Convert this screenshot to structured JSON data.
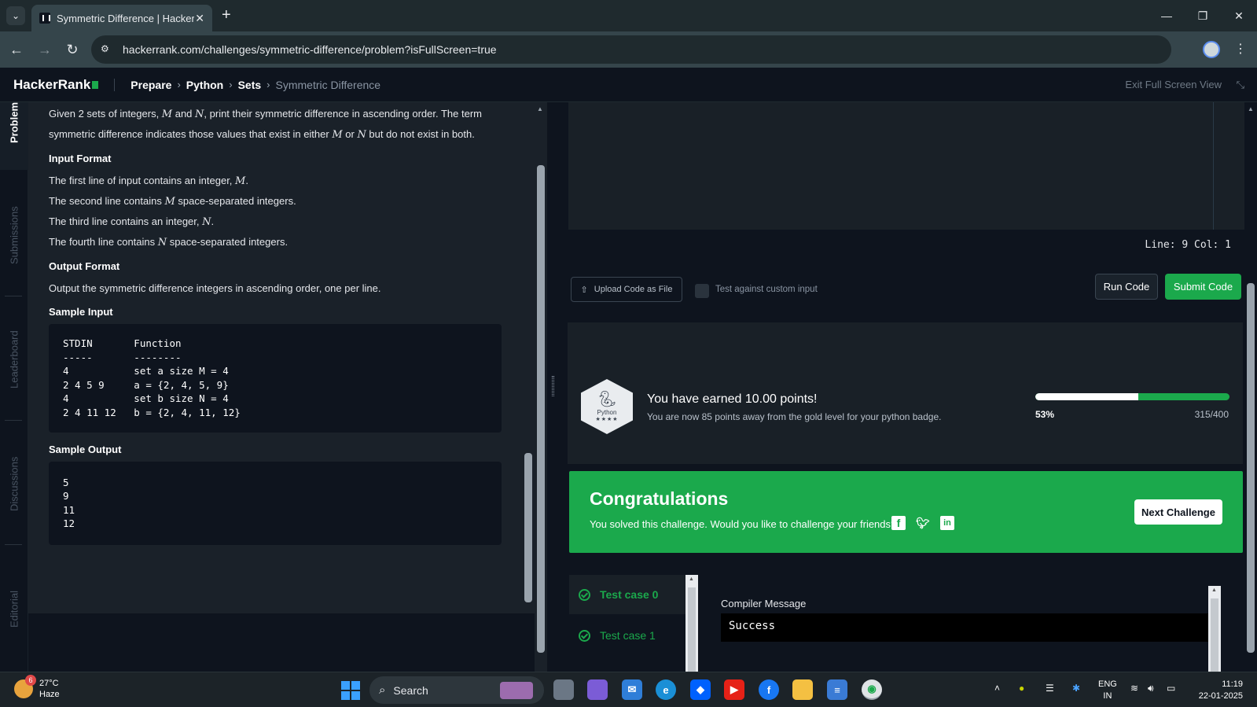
{
  "browser": {
    "tab_title": "Symmetric Difference | HackerRank",
    "url": "hackerrank.com/challenges/symmetric-difference/problem?isFullScreen=true"
  },
  "header": {
    "logo": "HackerRank",
    "breadcrumbs": [
      "Prepare",
      "Python",
      "Sets"
    ],
    "current": "Symmetric Difference",
    "exit_fullscreen": "Exit Full Screen View"
  },
  "vnav": {
    "items": [
      "Problem",
      "Submissions",
      "Leaderboard",
      "Discussions",
      "Editorial"
    ]
  },
  "problem": {
    "intro_a": "Given 2 sets of integers, ",
    "m": "M",
    "and": " and ",
    "n": "N",
    "intro_b": ", print their symmetric difference in ascending order. The term symmetric difference indicates those values that exist in either ",
    "or": " or ",
    "intro_c": " but do not exist in both.",
    "input_heading": "Input Format",
    "input_lines": [
      {
        "pre": "The first line of input contains an integer, ",
        "var": "M",
        "post": "."
      },
      {
        "pre": "The second line contains ",
        "var": "M",
        "post": " space-separated integers."
      },
      {
        "pre": "The third line contains an integer, ",
        "var": "N",
        "post": "."
      },
      {
        "pre": "The fourth line contains ",
        "var": "N",
        "post": " space-separated integers."
      }
    ],
    "output_heading": "Output Format",
    "output_text": "Output the symmetric difference integers in ascending order, one per line.",
    "sample_input_heading": "Sample Input",
    "sample_input": "STDIN       Function\n-----       --------\n4           set a size M = 4\n2 4 5 9     a = {2, 4, 5, 9}\n4           set b size N = 4\n2 4 11 12   b = {2, 4, 11, 12}",
    "sample_output_heading": "Sample Output",
    "sample_output": "5\n9\n11\n12"
  },
  "editor": {
    "status": "Line: 9 Col: 1"
  },
  "actions": {
    "upload": "Upload Code as File",
    "custom_input": "Test against custom input",
    "custom_input_checked": false,
    "run": "Run Code",
    "submit": "Submit Code"
  },
  "points": {
    "badge_label": "Python",
    "badge_stars": "★★★★",
    "earned": "You have earned 10.00 points!",
    "away": "You are now 85 points away from the gold level for your python badge.",
    "percent_label": "53%",
    "progress_fraction": 0.53,
    "score": "315/400"
  },
  "congrats": {
    "title": "Congratulations",
    "message": "You solved this challenge. Would you like to challenge your friends?",
    "next": "Next Challenge"
  },
  "results": {
    "test_cases": [
      "Test case 0",
      "Test case 1"
    ],
    "compiler_label": "Compiler Message",
    "compiler_message": "Success"
  },
  "taskbar": {
    "weather_temp": "27°C",
    "weather_desc": "Haze",
    "weather_badge": "6",
    "search": "Search",
    "lang_1": "ENG",
    "lang_2": "IN",
    "time": "11:19",
    "date": "22-01-2025"
  },
  "colors": {
    "accent_green": "#1ba94c",
    "page_bg": "#0e141e",
    "panel_bg": "#1a2129"
  }
}
